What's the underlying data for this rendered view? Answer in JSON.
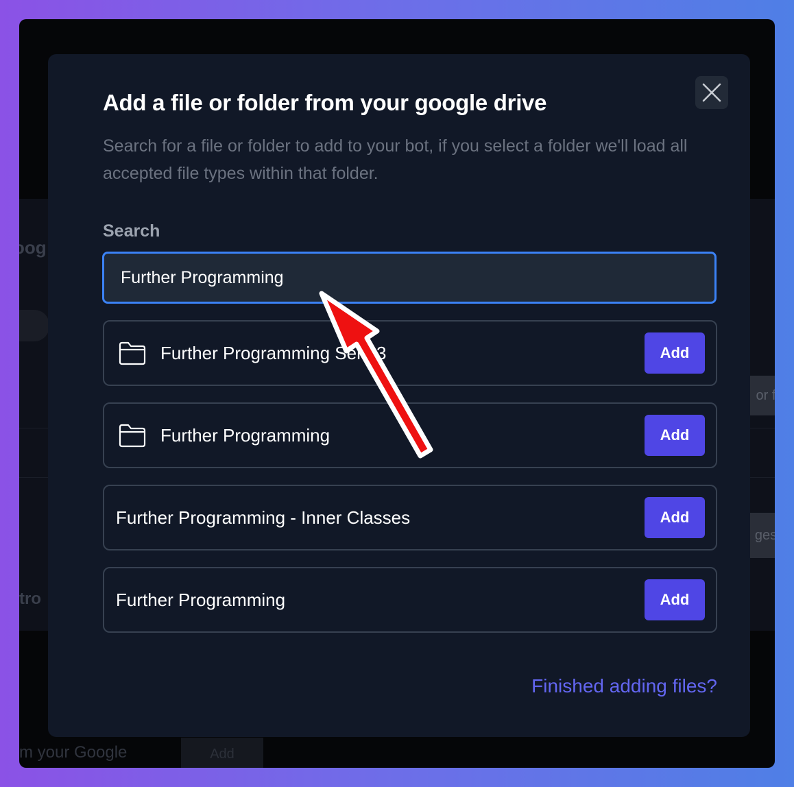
{
  "background_page": {
    "bg_fragment_1": "oog",
    "bg_fragment_2": "or f",
    "bg_fragment_3": "ges",
    "bg_fragment_4": "tro",
    "bottom_text": "m your Google",
    "bottom_button": "Add"
  },
  "modal": {
    "title": "Add a file or folder from your google drive",
    "description": "Search for a file or folder to add to your bot, if you select a folder we'll load all accepted file types within that folder.",
    "close_icon": "close-icon",
    "search": {
      "label": "Search",
      "value": "Further Programming"
    },
    "results": [
      {
        "name": "Further Programming Sem 3",
        "type": "folder",
        "icon": "folder-icon",
        "add_label": "Add"
      },
      {
        "name": "Further Programming",
        "type": "folder",
        "icon": "folder-icon",
        "add_label": "Add"
      },
      {
        "name": "Further Programming - Inner Classes",
        "type": "file",
        "add_label": "Add"
      },
      {
        "name": "Further Programming",
        "type": "file",
        "add_label": "Add"
      }
    ],
    "finished_link": "Finished adding files?"
  },
  "annotation": {
    "icon": "arrow-icon",
    "color": "#ee1111"
  },
  "colors": {
    "accent": "#4f46e5",
    "link": "#6366f1",
    "focus_border": "#3b82f6",
    "modal_bg": "#111827"
  }
}
